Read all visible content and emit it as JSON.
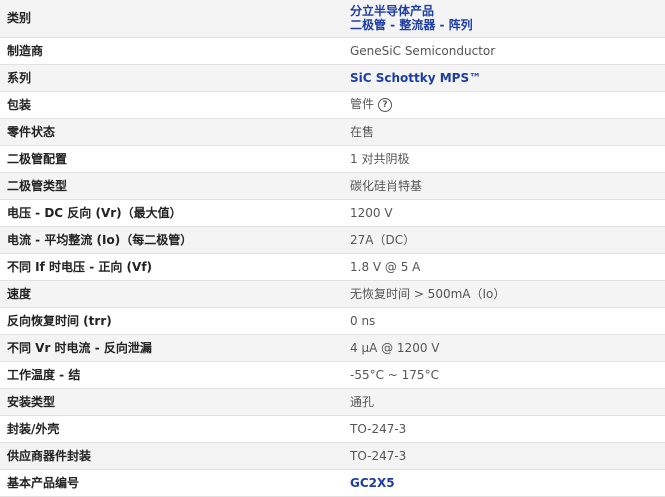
{
  "rows": {
    "category": {
      "label": "类别",
      "links": [
        "分立半导体产品",
        "二极管 - 整流器 - 阵列"
      ]
    },
    "manufacturer": {
      "label": "制造商",
      "value": "GeneSiC Semiconductor"
    },
    "series": {
      "label": "系列",
      "value": "SiC Schottky MPS™"
    },
    "packaging": {
      "label": "包装",
      "value": "管件",
      "help_icon": "question-circle-icon"
    },
    "part_status": {
      "label": "零件状态",
      "value": "在售"
    },
    "diode_config": {
      "label": "二极管配置",
      "value": "1 对共阴极"
    },
    "diode_type": {
      "label": "二极管类型",
      "value": "碳化硅肖特基"
    },
    "voltage_dc_reverse": {
      "label": "电压 - DC 反向 (Vr)（最大值）",
      "value": "1200 V"
    },
    "current_avg_rectified": {
      "label": "电流 - 平均整流 (Io)（每二极管）",
      "value": "27A（DC）"
    },
    "forward_voltage": {
      "label": "不同 If 时电压 - 正向 (Vf)",
      "value": "1.8 V @ 5 A"
    },
    "speed": {
      "label": "速度",
      "value": "无恢复时间 > 500mA（Io）"
    },
    "reverse_recovery_time": {
      "label": "反向恢复时间 (trr)",
      "value": "0 ns"
    },
    "reverse_leakage": {
      "label": "不同 Vr 时电流 - 反向泄漏",
      "value": "4 µA @ 1200 V"
    },
    "operating_temp": {
      "label": "工作温度 - 结",
      "value": "-55°C ~ 175°C"
    },
    "mounting_type": {
      "label": "安装类型",
      "value": "通孔"
    },
    "package_case": {
      "label": "封装/外壳",
      "value": "TO-247-3"
    },
    "supplier_package": {
      "label": "供应商器件封装",
      "value": "TO-247-3"
    },
    "base_part_number": {
      "label": "基本产品编号",
      "value": "GC2X5"
    }
  },
  "colors": {
    "link": "#1c3da5",
    "stripe": "#f4f4f4",
    "border": "#e2e2e2"
  }
}
